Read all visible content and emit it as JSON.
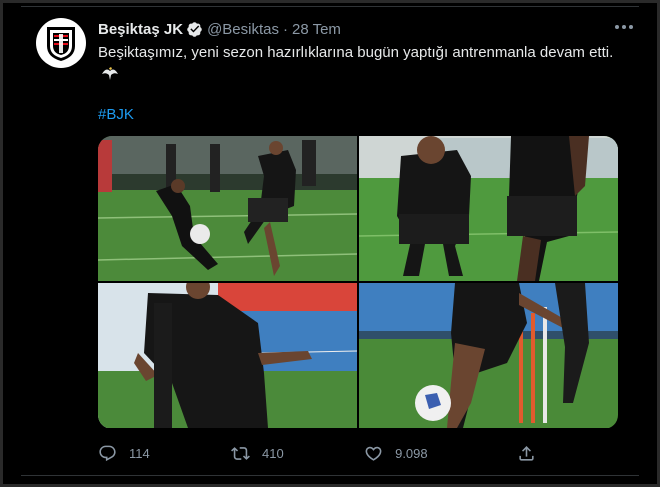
{
  "tweet": {
    "display_name": "Beşiktaş JK",
    "handle": "@Besiktas",
    "separator": "·",
    "date": "28 Tem",
    "text": "Beşiktaşımız, yeni sezon hazırlıklarına bugün yaptığı antrenmanla devam etti.",
    "hashtag": "#BJK",
    "emoji_icon": "eagle-icon"
  },
  "stats": {
    "replies": "114",
    "retweets": "410",
    "likes": "9.098"
  },
  "colors": {
    "background": "#000000",
    "text": "#e7e9ea",
    "muted": "#8b98a5",
    "link": "#1d9bf0",
    "verified": "#1d9bf0"
  }
}
